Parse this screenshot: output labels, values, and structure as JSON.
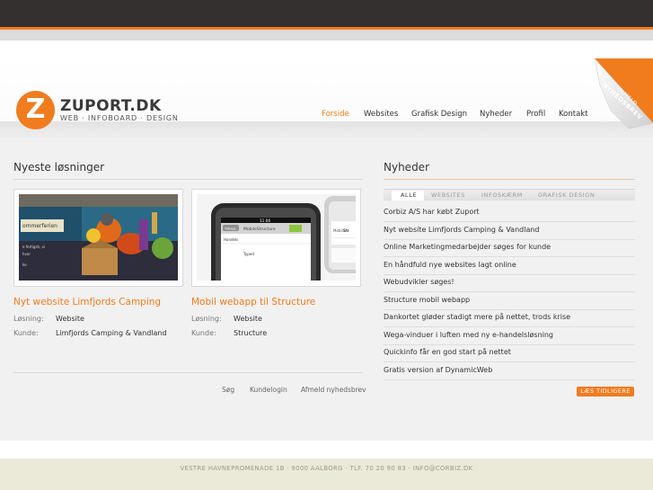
{
  "colors": {
    "accent": "#f07c1e",
    "topbar": "#353030",
    "footer_bg": "#ebe9d7"
  },
  "logo": {
    "letter": "Z",
    "title": "ZUPORT.DK",
    "subtitle": "WEB · INFOBOARD · DESIGN"
  },
  "nav": {
    "items": [
      "Forside",
      "Websites",
      "Grafisk Design",
      "Nyheder",
      "Profil",
      "Kontakt"
    ],
    "active": "Forside"
  },
  "ribbon": {
    "line1": "TILMELD",
    "line2": "NYHEDSBREV"
  },
  "solutions": {
    "title": "Nyeste løsninger",
    "items": [
      {
        "title": "Nyt website Limfjords Camping",
        "solution_label": "Løsning:",
        "solution": "Website",
        "client_label": "Kunde:",
        "client": "Limfjords Camping & Vandland",
        "image_icon": "camping-website-screenshot"
      },
      {
        "title": "Mobil webapp til Structure",
        "solution_label": "Løsning:",
        "solution": "Website",
        "client_label": "Kunde:",
        "client": "Structure",
        "image_icon": "iphone-webapp-screenshot"
      }
    ],
    "footer_links": [
      "Søg",
      "Kundelogin",
      "Afmeld nyhedsbrev"
    ]
  },
  "news": {
    "title": "Nyheder",
    "tabs": [
      "ALLE",
      "WEBSITES",
      "INFOSKÆRM",
      "GRAFISK DESIGN"
    ],
    "active_tab": "ALLE",
    "items": [
      "Corbiz A/S har købt Zuport",
      "Nyt website Limfjords Camping & Vandland",
      "Online Marketingmedarbejder søges for kunde",
      "En håndfuld nye websites lagt online",
      "Webudvikler søges!",
      "Structure mobil webapp",
      "Dankortet gløder stadigt mere på nettet, trods krise",
      "Wega-vinduer i luften med ny e-handelsløsning",
      "Quickinfo får en god start på nettet",
      "Gratis version af DynamicWeb"
    ],
    "more_button": "LÆS TIDLIGERE"
  },
  "mock_phone": {
    "time": "11.06",
    "app_title": "MobileStructure",
    "back": "Tilbage",
    "row1": "Handels",
    "row2": "Typed"
  },
  "footer": {
    "text": "VESTRE HAVNEPROMENADE 1B · 9000 AALBORG · TLF. 70 20 90 83 · INFO@CORBIZ.DK"
  }
}
